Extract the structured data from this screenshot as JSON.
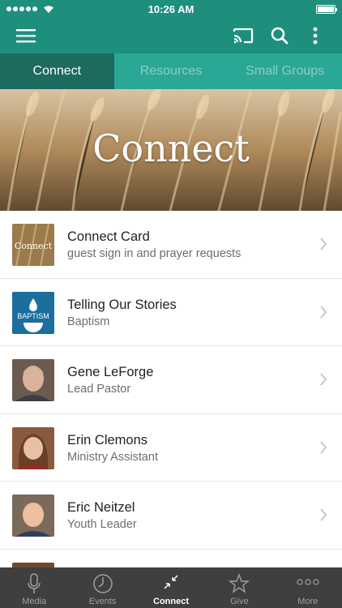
{
  "status_bar": {
    "time": "10:26 AM",
    "signal_icon": "signal-dots-icon",
    "wifi_icon": "wifi-icon",
    "battery_icon": "battery-icon"
  },
  "app_bar": {
    "menu_icon": "hamburger-menu-icon",
    "cast_icon": "cast-icon",
    "search_icon": "search-icon",
    "more_icon": "more-vertical-icon",
    "color": "#1e8f7d"
  },
  "tabs": [
    {
      "label": "Connect",
      "active": true
    },
    {
      "label": "Resources",
      "active": false
    },
    {
      "label": "Small Groups",
      "active": false
    }
  ],
  "hero": {
    "title": "Connect",
    "background": "wheat-field-image"
  },
  "list": [
    {
      "title": "Connect Card",
      "subtitle": "guest sign in and prayer requests",
      "thumb_text": "Connect",
      "thumb": "connect-card-thumb"
    },
    {
      "title": "Telling Our Stories",
      "subtitle": "Baptism",
      "thumb_text": "BAPTISM",
      "thumb": "baptism-thumb"
    },
    {
      "title": "Gene LeForge",
      "subtitle": "Lead Pastor",
      "thumb": "avatar"
    },
    {
      "title": "Erin Clemons",
      "subtitle": "Ministry Assistant",
      "thumb": "avatar"
    },
    {
      "title": "Eric Neitzel",
      "subtitle": "Youth Leader",
      "thumb": "avatar"
    }
  ],
  "bottom_nav": [
    {
      "label": "Media",
      "icon": "microphone-icon",
      "active": false
    },
    {
      "label": "Events",
      "icon": "clock-icon",
      "active": false
    },
    {
      "label": "Connect",
      "icon": "connect-arrows-icon",
      "active": true
    },
    {
      "label": "Give",
      "icon": "star-icon",
      "active": false
    },
    {
      "label": "More",
      "icon": "more-dots-icon",
      "active": false
    }
  ],
  "colors": {
    "primary": "#1e8f7d",
    "tab_bar": "#2ba795",
    "tab_active": "#1d6a5f",
    "bottom_nav": "#3f3f3f"
  }
}
